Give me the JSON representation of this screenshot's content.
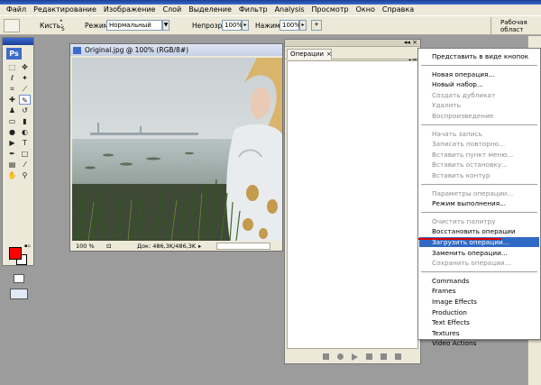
{
  "menubar": {
    "items": [
      "Файл",
      "Редактирование",
      "Изображение",
      "Слой",
      "Выделение",
      "Фильтр",
      "Analysis",
      "Просмотр",
      "Окно",
      "Справка"
    ]
  },
  "options": {
    "brushes_label": "Кисть:",
    "brush_size": "5",
    "mode_label": "Режим:",
    "mode_value": "Нормальный",
    "opacity_label": "Непрозр.:",
    "opacity_value": "100%",
    "pressure_label": "Нажим:",
    "pressure_value": "100%",
    "workspace_label": "Рабочая област"
  },
  "toolbox": {
    "logo": "Ps",
    "foreground_color": "#ff0000",
    "background_color": "#ffffff"
  },
  "document": {
    "title": "Original.jpg @ 100% (RGB/8#)",
    "zoom": "100 %",
    "doc_size": "Док: 486,3K/486,3K"
  },
  "actions_panel": {
    "tab_label": "Операции",
    "close_glyph": "×",
    "menu_glyph": "▸≡"
  },
  "context_menu": {
    "groups": [
      [
        {
          "label": "Представить в виде кнопок",
          "enabled": true
        }
      ],
      [
        {
          "label": "Новая операция...",
          "enabled": true
        },
        {
          "label": "Новый набор...",
          "enabled": true
        },
        {
          "label": "Создать дубликат",
          "enabled": false
        },
        {
          "label": "Удалить",
          "enabled": false
        },
        {
          "label": "Воспроизведение",
          "enabled": false
        }
      ],
      [
        {
          "label": "Начать запись",
          "enabled": false
        },
        {
          "label": "Записать повторно...",
          "enabled": false
        },
        {
          "label": "Вставить пункт меню...",
          "enabled": false
        },
        {
          "label": "Вставить остановку...",
          "enabled": false
        },
        {
          "label": "Вставить контур",
          "enabled": false
        }
      ],
      [
        {
          "label": "Параметры операции...",
          "enabled": false
        },
        {
          "label": "Режим выполнения...",
          "enabled": true
        }
      ],
      [
        {
          "label": "Очистить палитру",
          "enabled": false
        },
        {
          "label": "Восстановить операции",
          "enabled": true
        },
        {
          "label": "Загрузить операции...",
          "enabled": true,
          "highlighted": true
        },
        {
          "label": "Заменить операции...",
          "enabled": true
        },
        {
          "label": "Сохранить операции...",
          "enabled": false
        }
      ],
      [
        {
          "label": "Commands",
          "enabled": true
        },
        {
          "label": "Frames",
          "enabled": true
        },
        {
          "label": "Image Effects",
          "enabled": true
        },
        {
          "label": "Production",
          "enabled": true
        },
        {
          "label": "Text Effects",
          "enabled": true
        },
        {
          "label": "Textures",
          "enabled": true
        },
        {
          "label": "Video Actions",
          "enabled": true
        }
      ]
    ]
  }
}
